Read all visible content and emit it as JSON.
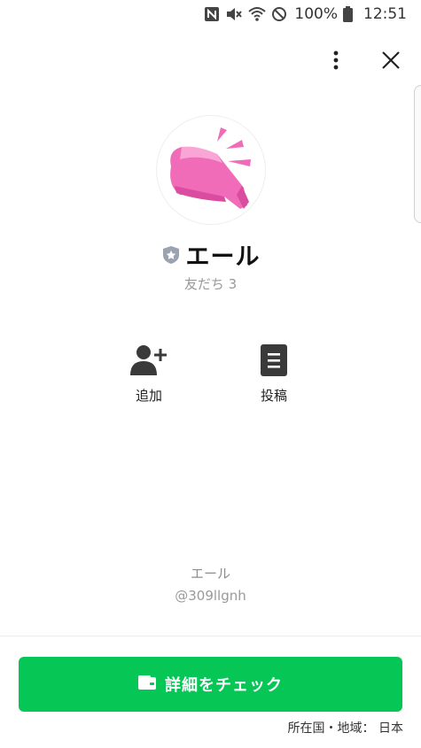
{
  "status_bar": {
    "battery": "100%",
    "time": "12:51",
    "icons": [
      "nfc-icon",
      "mute-icon",
      "wifi-icon",
      "do-not-disturb-icon",
      "battery-icon"
    ]
  },
  "header": {
    "more_icon": "more-vertical-icon",
    "close_icon": "close-icon"
  },
  "profile": {
    "name": "エール",
    "friends": "友だち 3",
    "badge_icon": "certified-badge-icon",
    "avatar_icon": "megaphone-icon"
  },
  "actions": [
    {
      "label": "追加",
      "icon": "add-friend-icon"
    },
    {
      "label": "投稿",
      "icon": "post-icon"
    }
  ],
  "meta": {
    "display_name": "エール",
    "line_id": "@309llgnh"
  },
  "cta": {
    "label": "詳細をチェック",
    "icon": "wallet-icon"
  },
  "footer": {
    "region": "所在国・地域： 日本"
  },
  "colors": {
    "cta_green": "#06c755",
    "avatar_pink": "#f06bb8"
  }
}
